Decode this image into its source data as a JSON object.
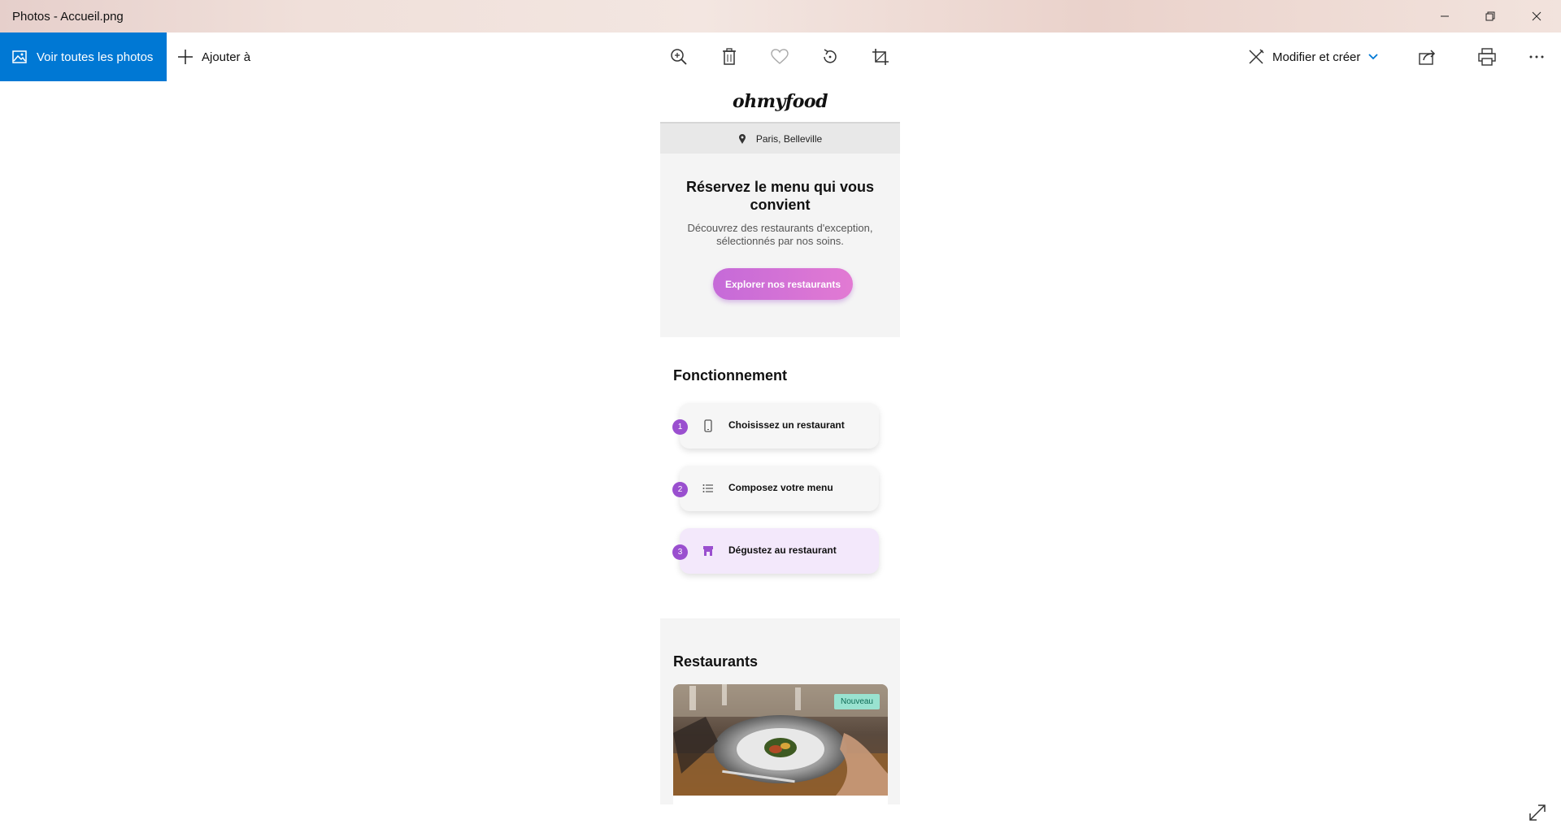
{
  "window": {
    "title": "Photos - Accueil.png"
  },
  "toolbar": {
    "see_all_label": "Voir toutes les photos",
    "add_label": "Ajouter à",
    "edit_label": "Modifier et créer",
    "tools": [
      "zoom-in-icon",
      "trash-icon",
      "heart-icon",
      "rotate-icon",
      "crop-icon",
      "share-icon",
      "print-icon",
      "more-icon"
    ]
  },
  "mockup": {
    "logo": "ohmyfood",
    "location": "Paris, Belleville",
    "hero": {
      "title": "Réservez le menu qui vous convient",
      "subtitle": "Découvrez des restaurants d'exception, sélectionnés par nos soins.",
      "cta": "Explorer nos restaurants"
    },
    "howto": {
      "title": "Fonctionnement",
      "steps": [
        {
          "number": "1",
          "icon": "phone-icon",
          "label": "Choisissez un restaurant"
        },
        {
          "number": "2",
          "icon": "list-icon",
          "label": "Composez votre menu"
        },
        {
          "number": "3",
          "icon": "store-icon",
          "label": "Dégustez au restaurant"
        }
      ]
    },
    "restaurants": {
      "title": "Restaurants",
      "badge": "Nouveau"
    }
  },
  "colors": {
    "accent_blue": "#0078d4",
    "purple": "#9a4fcf",
    "cta_gradient_start": "#c56ad8",
    "cta_gradient_end": "#e27ad3",
    "badge_bg": "#99e2d0"
  }
}
